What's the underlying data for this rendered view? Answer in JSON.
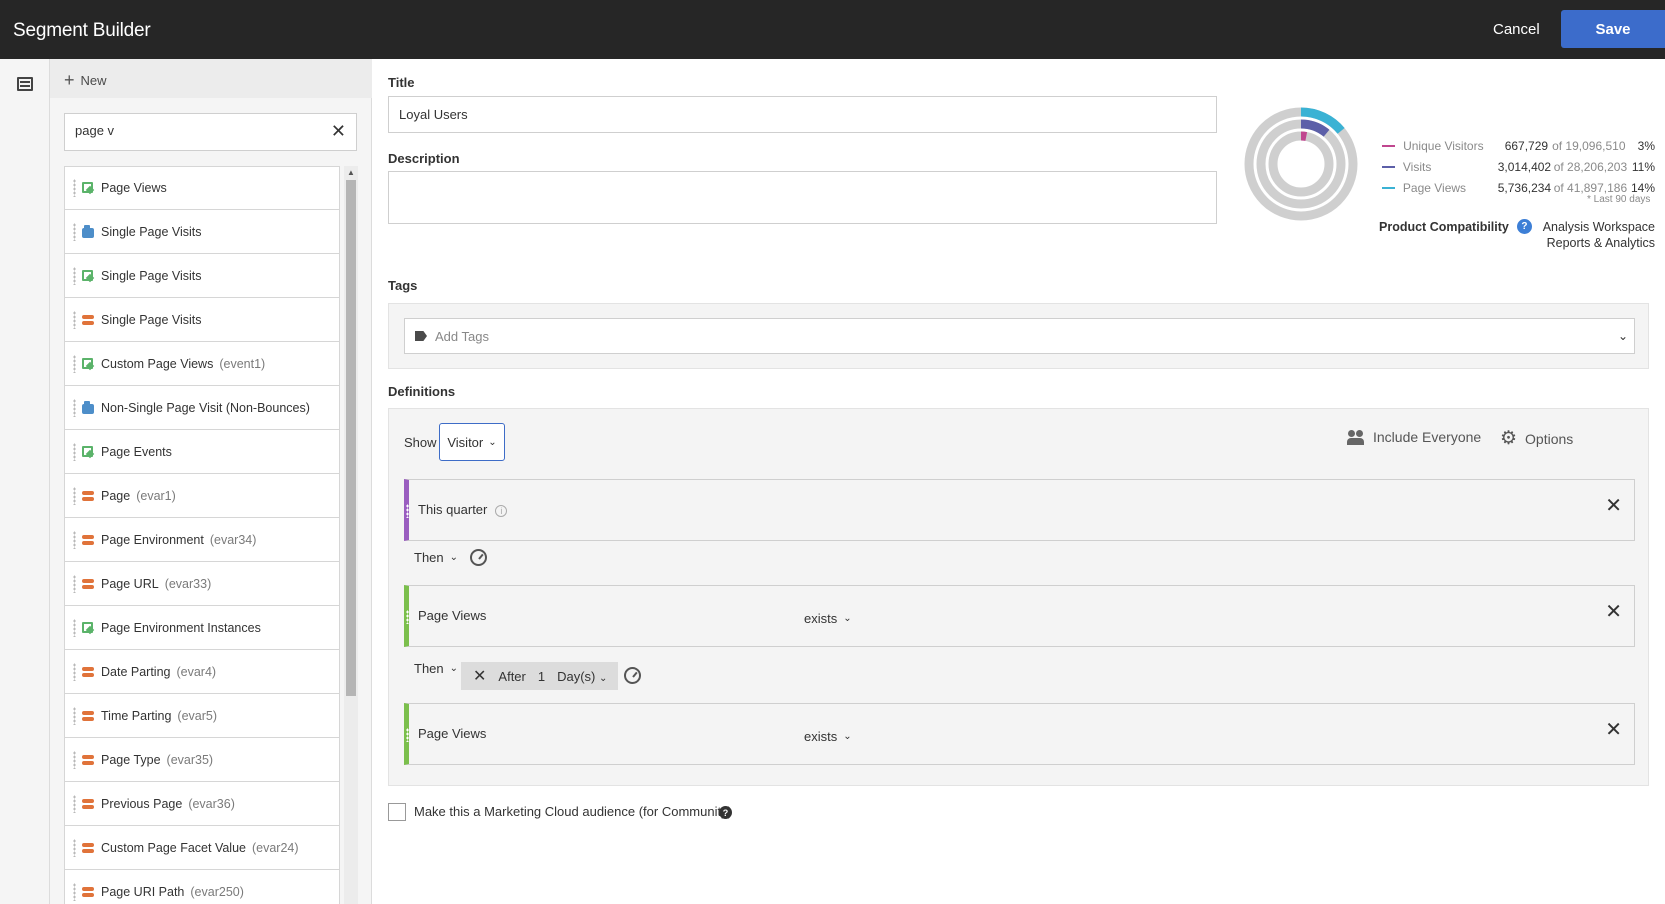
{
  "header": {
    "title": "Segment Builder",
    "cancel_label": "Cancel",
    "save_label": "Save"
  },
  "rail": {
    "icon": "segments-list-icon"
  },
  "panel": {
    "new_label": "New",
    "search": {
      "value": "page v"
    },
    "items": [
      {
        "icon": "metric",
        "label": "Page Views",
        "sub": ""
      },
      {
        "icon": "segment",
        "label": "Single Page Visits",
        "sub": ""
      },
      {
        "icon": "metric",
        "label": "Single Page Visits",
        "sub": ""
      },
      {
        "icon": "dimension",
        "label": "Single Page Visits",
        "sub": ""
      },
      {
        "icon": "metric",
        "label": "Custom Page Views",
        "sub": "(event1)"
      },
      {
        "icon": "segment",
        "label": "Non-Single Page Visit (Non-Bounces)",
        "sub": ""
      },
      {
        "icon": "metric",
        "label": "Page Events",
        "sub": ""
      },
      {
        "icon": "dimension",
        "label": "Page",
        "sub": "(evar1)"
      },
      {
        "icon": "dimension",
        "label": "Page Environment",
        "sub": "(evar34)"
      },
      {
        "icon": "dimension",
        "label": "Page URL",
        "sub": "(evar33)"
      },
      {
        "icon": "metric",
        "label": "Page Environment Instances",
        "sub": ""
      },
      {
        "icon": "dimension",
        "label": "Date Parting",
        "sub": "(evar4)"
      },
      {
        "icon": "dimension",
        "label": "Time Parting",
        "sub": "(evar5)"
      },
      {
        "icon": "dimension",
        "label": "Page Type",
        "sub": "(evar35)"
      },
      {
        "icon": "dimension",
        "label": "Previous Page",
        "sub": "(evar36)"
      },
      {
        "icon": "dimension",
        "label": "Custom Page Facet Value",
        "sub": "(evar24)"
      },
      {
        "icon": "dimension",
        "label": "Page URI Path",
        "sub": "(evar250)"
      }
    ]
  },
  "form": {
    "title_label": "Title",
    "title_value": "Loyal Users",
    "description_label": "Description",
    "description_value": "",
    "tags_label": "Tags",
    "tags_placeholder": "Add Tags",
    "definitions_label": "Definitions"
  },
  "summary": {
    "metrics": [
      {
        "name": "Unique Visitors",
        "value": "667,729",
        "of": "of 19,096,510",
        "pct": "3%",
        "fraction": 0.03,
        "color": "#c0468f"
      },
      {
        "name": "Visits",
        "value": "3,014,402",
        "of": "of 28,206,203",
        "pct": "11%",
        "fraction": 0.11,
        "color": "#5c5fa8"
      },
      {
        "name": "Page Views",
        "value": "5,736,234",
        "of": "of 41,897,186",
        "pct": "14%",
        "fraction": 0.14,
        "color": "#3ab2d4"
      }
    ],
    "note": "* Last 90 days",
    "compat_label": "Product Compatibility",
    "compat_values": [
      "Analysis Workspace",
      "Reports & Analytics"
    ]
  },
  "definitions": {
    "show_label": "Show",
    "container": "Visitor",
    "include_label": "Include Everyone",
    "options_label": "Options",
    "rules": [
      {
        "name": "This quarter",
        "operator": "",
        "color": "#9a5ec0"
      },
      {
        "name": "Page Views",
        "operator": "exists",
        "color": "#7bbf4c"
      },
      {
        "name": "Page Views",
        "operator": "exists",
        "color": "#7bbf4c"
      }
    ],
    "then_label": "Then",
    "after": {
      "label": "After",
      "count": "1",
      "unit": "Day(s)"
    }
  },
  "audience": {
    "label": "Make this a Marketing Cloud audience (for Community)",
    "checked": false
  }
}
